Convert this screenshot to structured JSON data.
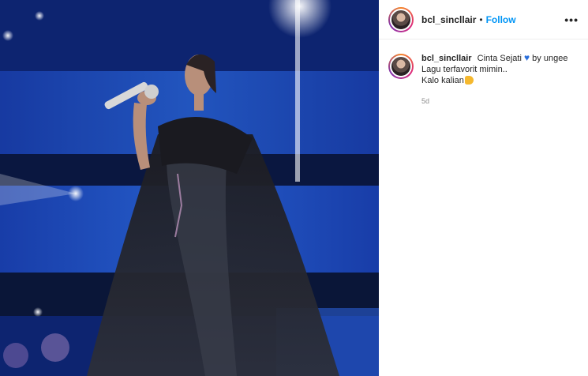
{
  "post": {
    "username": "bcl_sincllair",
    "separator": "•",
    "follow_label": "Follow",
    "more_label": "•••"
  },
  "caption": {
    "username": "bcl_sincllair",
    "line1_text": "Cinta Sejati",
    "heart_icon": "♥",
    "line1_suffix": "by ungee",
    "line2": "Lagu terfavorit mimin..",
    "line3": "Kalo kalian",
    "timestamp": "5d"
  },
  "colors": {
    "accent": "#0095f6",
    "heart": "#2a6fdb",
    "timestamp": "#8e8e8e"
  }
}
